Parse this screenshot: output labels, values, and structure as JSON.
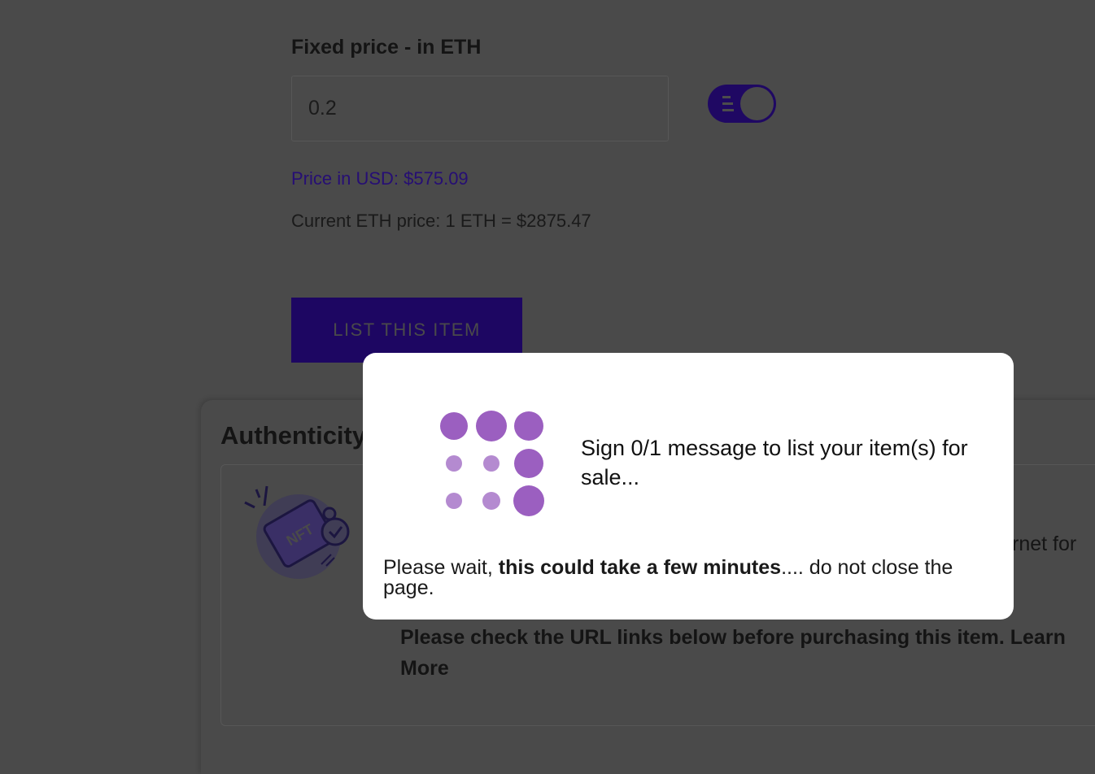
{
  "listing_form": {
    "price_label": "Fixed price - in ETH",
    "price_value": "0.2",
    "toggle_on": true,
    "usd_price": "Price in USD: $575.09",
    "eth_price": "Current ETH price: 1 ETH = $2875.47",
    "list_button_label": "LIST THIS ITEM"
  },
  "authenticity": {
    "title": "Authenticity",
    "text_fragment": "rnet for",
    "warning": "Please check the URL links below before purchasing this item. Learn More",
    "badge_text": "NFT"
  },
  "modal": {
    "message": "Sign 0/1 message to list your item(s) for sale...",
    "note_prefix": "Please wait, ",
    "note_bold": "this could take a few minutes",
    "note_suffix": ".... do not close the page."
  },
  "colors": {
    "brand_purple": "#1d0662",
    "spinner_purple": "#9b5fc0",
    "overlay": "#4a4a4a"
  }
}
